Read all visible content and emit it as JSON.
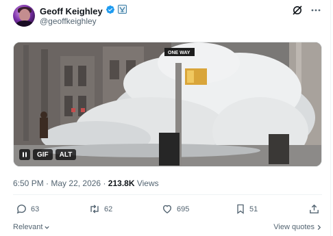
{
  "author": {
    "display_name": "Geoff Keighley",
    "handle": "@geoffkeighley",
    "icons": [
      "verified-badge-icon",
      "affiliate-badge-icon"
    ]
  },
  "header_icons": [
    "grok-icon",
    "more-icon"
  ],
  "media": {
    "type": "GIF",
    "controls": {
      "gif_label": "GIF",
      "alt_label": "ALT"
    },
    "street_sign_text": "ONE WAY"
  },
  "meta": {
    "time": "6:50 PM",
    "separator": "·",
    "date": "May 22, 2026",
    "views_count": "213.8K",
    "views_label": "Views"
  },
  "actions": {
    "replies": "63",
    "reposts": "62",
    "likes": "695",
    "bookmarks": "51"
  },
  "footer": {
    "sort_label": "Relevant",
    "view_quotes_label": "View quotes"
  },
  "colors": {
    "text_primary": "#0f1419",
    "text_secondary": "#536471",
    "verified_blue": "#1d9bf0",
    "affiliate_badge": "#3a7ca5"
  }
}
